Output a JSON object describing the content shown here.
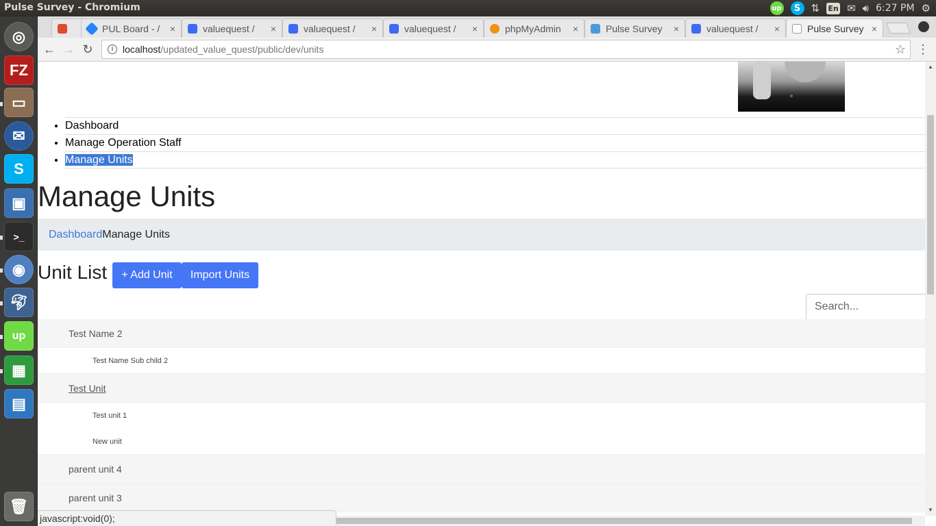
{
  "os": {
    "window_title": "Pulse Survey - Chromium",
    "clock": "6:27 PM",
    "keyboard": "En",
    "tray_upwork": "up",
    "tray_skype": "S"
  },
  "launcher": {
    "items": [
      "dash-icon",
      "filezilla-icon",
      "files-icon",
      "thunderbird-icon",
      "skype-icon",
      "virtualbox-icon",
      "terminal-icon",
      "chromium-icon",
      "mysql-workbench-icon",
      "upwork-icon",
      "calc-icon",
      "impress-icon",
      "trash-icon"
    ],
    "labels": {
      "filezilla": "FZ",
      "skype": "S",
      "upwork": "up",
      "terminal": ">_"
    }
  },
  "browser": {
    "tabs": [
      {
        "title": "",
        "favicon_color": "#e04a2f",
        "close": "×"
      },
      {
        "title": "PUL Board - /",
        "favicon_color": "#2684ff",
        "close": "×"
      },
      {
        "title": "valuequest /",
        "favicon_color": "#3d6bf5",
        "close": "×"
      },
      {
        "title": "valuequest /",
        "favicon_color": "#3d6bf5",
        "close": "×"
      },
      {
        "title": "valuequest /",
        "favicon_color": "#3d6bf5",
        "close": "×"
      },
      {
        "title": "phpMyAdmin",
        "favicon_color": "#f29111",
        "close": "×"
      },
      {
        "title": "Pulse Survey",
        "favicon_color": "#4a9ad9",
        "close": "×"
      },
      {
        "title": "valuequest /",
        "favicon_color": "#3d6bf5",
        "close": "×"
      },
      {
        "title": "Pulse Survey",
        "favicon_color": "#bbbbbb",
        "close": "×"
      }
    ],
    "active_tab_index": 8,
    "url_host": "localhost",
    "url_path": "/updated_value_quest/public/dev/units",
    "status_text": "javascript:void(0);"
  },
  "page": {
    "nav": [
      {
        "label": "Dashboard"
      },
      {
        "label": "Manage Operation Staff"
      },
      {
        "label": "Manage Units",
        "selected": true
      }
    ],
    "title": "Manage Units",
    "breadcrumb": {
      "link": "Dashboard",
      "current": "Manage Units"
    },
    "section_title": "Unit List",
    "buttons": {
      "add_unit": "+ Add Unit",
      "import_units": "Import Units"
    },
    "search_placeholder": "Search...",
    "units": [
      {
        "name": "Test Name 2",
        "children": [
          "Test Name Sub child 2"
        ]
      },
      {
        "name": "Test Unit",
        "hovered": true,
        "children": [
          "Test unit 1",
          "New unit"
        ]
      },
      {
        "name": "parent unit 4",
        "children": []
      },
      {
        "name": "parent unit 3",
        "children": []
      }
    ]
  }
}
